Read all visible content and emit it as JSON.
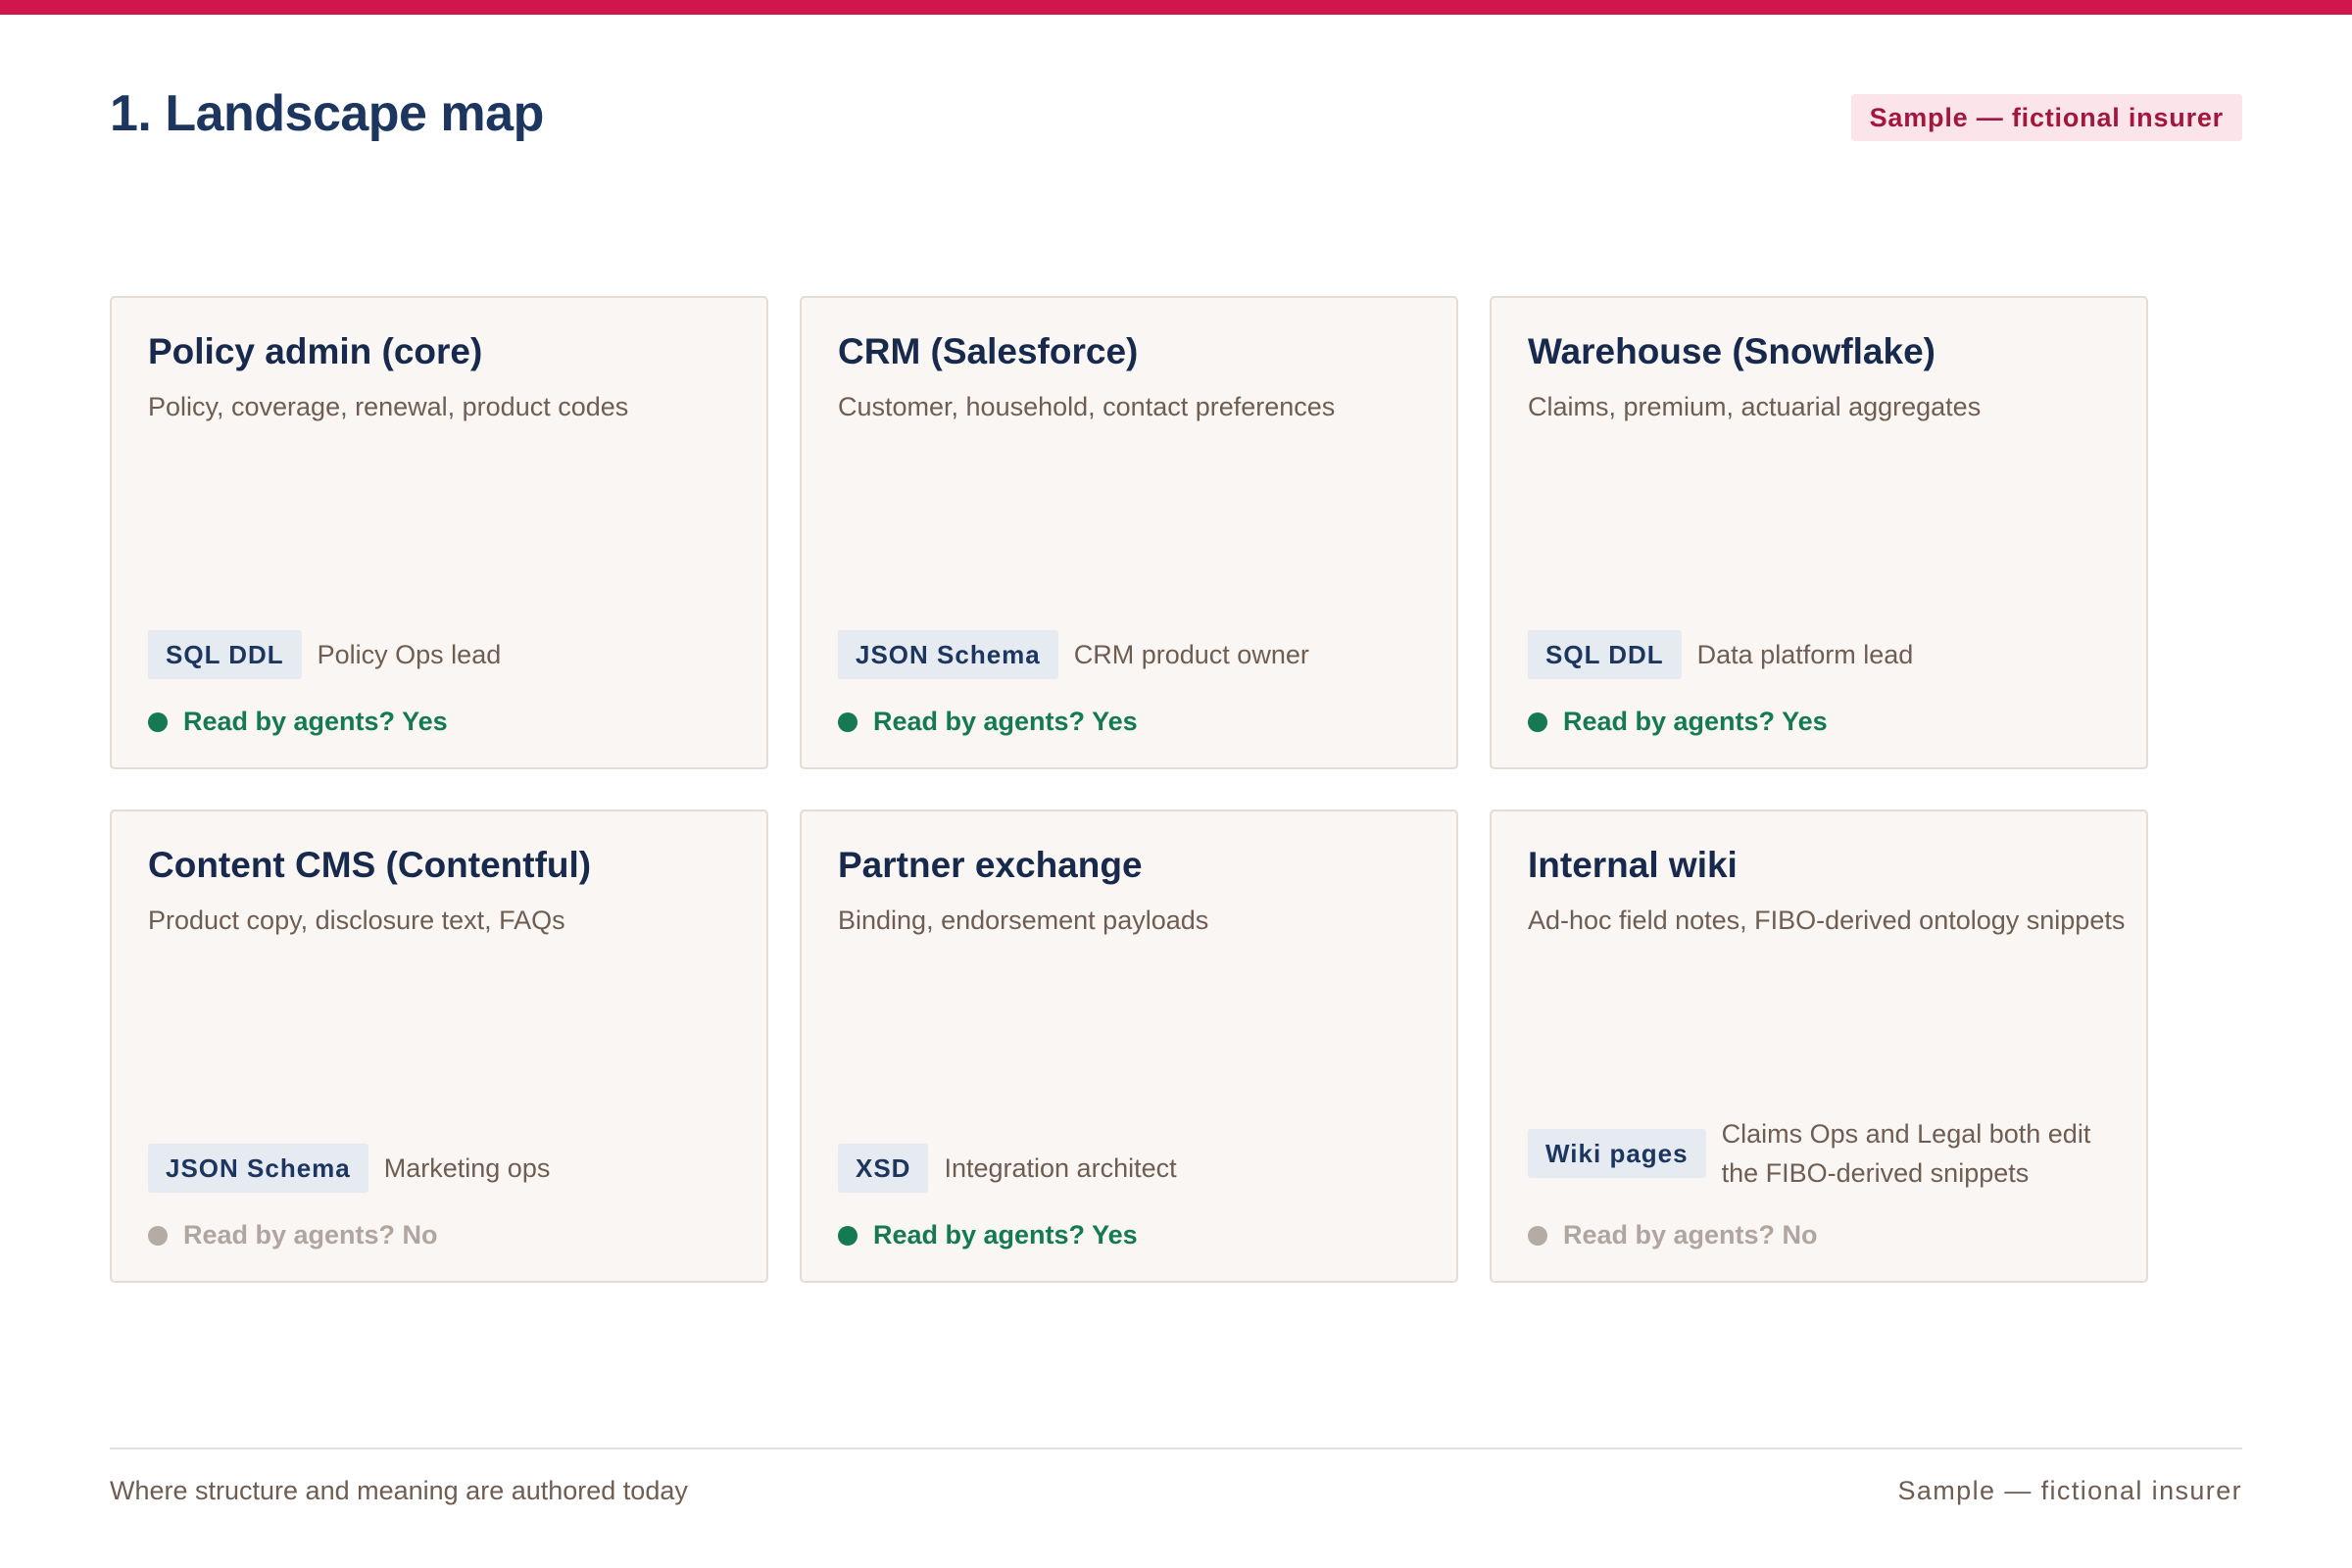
{
  "page": {
    "title": "1. Landscape map",
    "badge": "Sample — fictional insurer"
  },
  "colors": {
    "accent_bar": "#d0164a",
    "title": "#1d3660",
    "yes": "#157a52",
    "no": "#b5aba5"
  },
  "cards": [
    {
      "title": "Policy admin (core)",
      "description": "Policy, coverage, renewal, product codes",
      "format": "SQL DDL",
      "owner": "Policy Ops lead",
      "agents": "Read by agents? Yes",
      "agents_read": true
    },
    {
      "title": "CRM (Salesforce)",
      "description": "Customer, household, contact preferences",
      "format": "JSON Schema",
      "owner": "CRM product owner",
      "agents": "Read by agents? Yes",
      "agents_read": true
    },
    {
      "title": "Warehouse (Snowflake)",
      "description": "Claims, premium, actuarial aggregates",
      "format": "SQL DDL",
      "owner": "Data platform lead",
      "agents": "Read by agents? Yes",
      "agents_read": true
    },
    {
      "title": "Content CMS (Contentful)",
      "description": "Product copy, disclosure text, FAQs",
      "format": "JSON Schema",
      "owner": "Marketing ops",
      "agents": "Read by agents? No",
      "agents_read": false
    },
    {
      "title": "Partner exchange",
      "description": "Binding, endorsement payloads",
      "format": "XSD",
      "owner": "Integration architect",
      "agents": "Read by agents? Yes",
      "agents_read": true
    },
    {
      "title": "Internal wiki",
      "description": "Ad-hoc field notes, FIBO-derived ontology snippets",
      "format": "Wiki pages",
      "owner": "Claims Ops and Legal both edit the FIBO-derived snippets",
      "agents": "Read by agents? No",
      "agents_read": false
    }
  ],
  "footer": {
    "left": "Where structure and meaning are authored today",
    "right": "Sample — fictional insurer"
  }
}
